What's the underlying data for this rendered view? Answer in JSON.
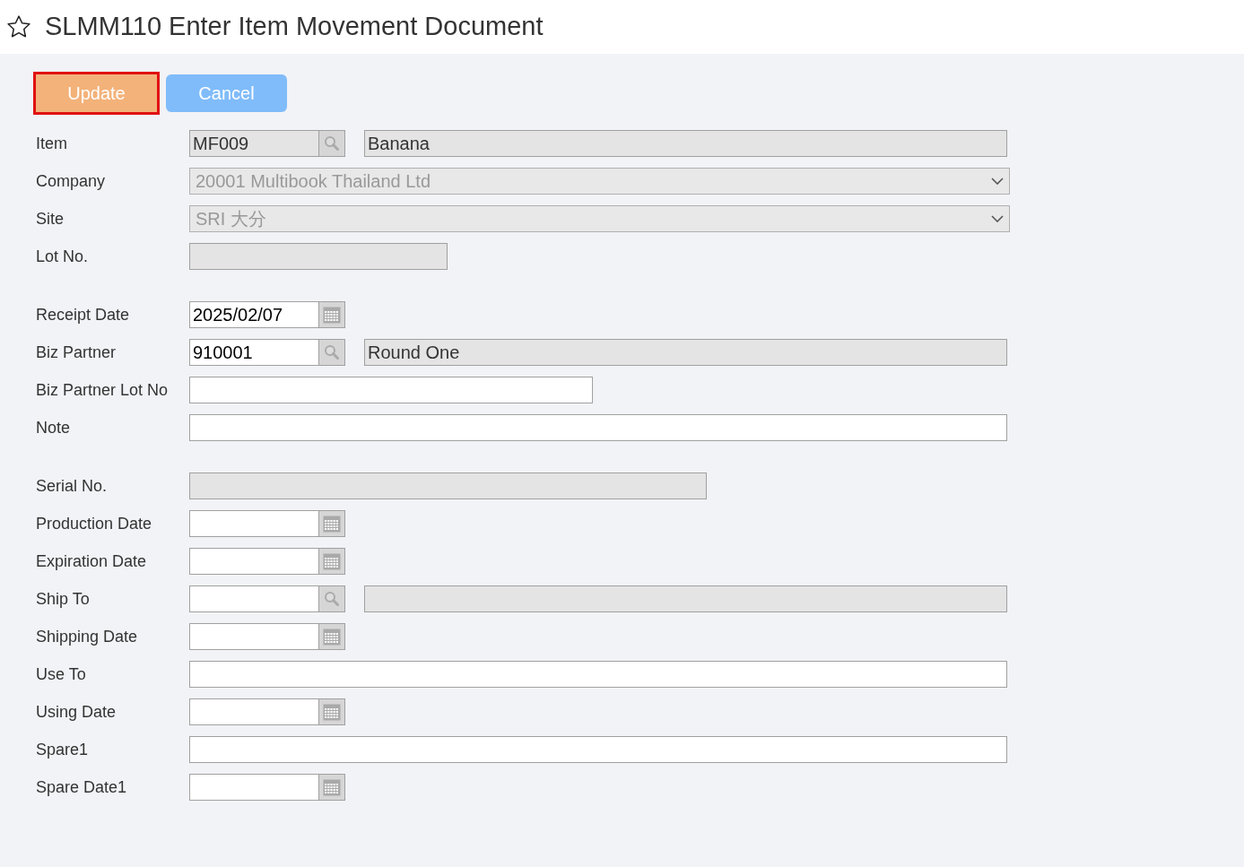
{
  "title": "SLMM110 Enter Item Movement Document",
  "favorite": false,
  "buttons": [
    {
      "label": "Update",
      "kind": "primary",
      "highlighted": true
    },
    {
      "label": "Cancel",
      "kind": "secondary",
      "highlighted": false
    }
  ],
  "groups": [
    {
      "fields": [
        {
          "label": "Item",
          "kind": "lookup",
          "value": "MF009",
          "disabled": true,
          "name": "Banana"
        },
        {
          "label": "Company",
          "kind": "select",
          "value": "20001 Multibook Thailand Ltd",
          "disabled": true
        },
        {
          "label": "Site",
          "kind": "select",
          "value": "SRI 大分",
          "disabled": true
        },
        {
          "label": "Lot No.",
          "kind": "shorttext",
          "disabled": true
        }
      ]
    },
    {
      "fields": [
        {
          "label": "Receipt Date",
          "kind": "date",
          "value": "2025/02/07",
          "disabled": false
        },
        {
          "label": "Biz Partner",
          "kind": "lookup",
          "value": "910001",
          "disabled": false,
          "name": "Round One"
        },
        {
          "label": "Biz Partner Lot No",
          "kind": "mediumtext",
          "disabled": false
        },
        {
          "label": "Note",
          "kind": "widetext",
          "disabled": false
        }
      ]
    },
    {
      "fields": [
        {
          "label": "Serial No.",
          "kind": "longtext",
          "disabled": true
        },
        {
          "label": "Production Date",
          "kind": "date",
          "disabled": false
        },
        {
          "label": "Expiration Date",
          "kind": "date",
          "disabled": false
        },
        {
          "label": "Ship To",
          "kind": "lookup",
          "disabled": false
        },
        {
          "label": "Shipping Date",
          "kind": "date",
          "disabled": false
        },
        {
          "label": "Use To",
          "kind": "widetext",
          "disabled": false
        },
        {
          "label": "Using Date",
          "kind": "date",
          "disabled": false
        },
        {
          "label": "Spare1",
          "kind": "widetext",
          "disabled": false
        },
        {
          "label": "Spare Date1",
          "kind": "date",
          "disabled": false
        }
      ]
    }
  ]
}
